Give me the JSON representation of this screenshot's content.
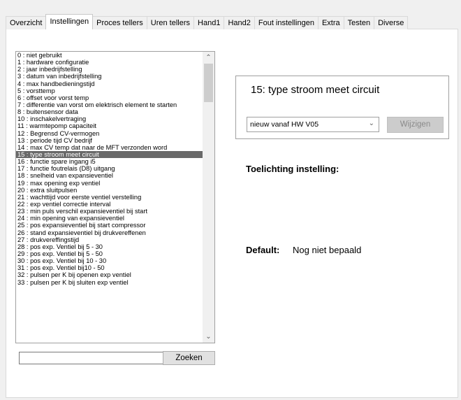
{
  "tabs": [
    {
      "label": "Overzicht",
      "active": false
    },
    {
      "label": "Instellingen",
      "active": true
    },
    {
      "label": "Proces tellers",
      "active": false
    },
    {
      "label": "Uren tellers",
      "active": false
    },
    {
      "label": "Hand1",
      "active": false
    },
    {
      "label": "Hand2",
      "active": false
    },
    {
      "label": "Fout instellingen",
      "active": false
    },
    {
      "label": "Extra",
      "active": false
    },
    {
      "label": "Testen",
      "active": false
    },
    {
      "label": "Diverse",
      "active": false
    }
  ],
  "settings_list": {
    "selected_index": 15,
    "items": [
      "0 : niet gebruikt",
      "1 : hardware configuratie",
      "2 : jaar inbedrijfstelling",
      "3 : datum van inbedrijfstelling",
      "4 : max handbedieningstijd",
      "5 : vorsttemp",
      "6 : offset voor vorst temp",
      "7 : differentie van vorst om elektrisch element te starten",
      "8 : buitensensor data",
      "10 : inschakelvertraging",
      "11 : warmtepomp capaciteit",
      "12 : Begrensd CV-vermogen",
      "13 : periode tijd CV bedrijf",
      "14 : max CV temp dat naar de MFT verzonden word",
      "15 : type stroom meet circuit",
      "16 : functie spare ingang i5",
      "17 : functie foutrelais (D8) uitgang",
      "18 : snelheid van expansieventiel",
      "19 : max opening exp ventiel",
      "20 : extra sluitpulsen",
      "21 : wachttijd voor eerste ventiel verstelling",
      "22 : exp ventiel correctie interval",
      "23 : min puls verschil expansieventiel bij start",
      "24 : min opening van expansieventiel",
      "25 : pos expansieventiel bij start compressor",
      "26 : stand expansieventiel bij drukvereffenen",
      "27 : drukvereffingstijd",
      "28 : pos exp. Ventiel bij 5 - 30",
      "29 : pos exp. Ventiel bij 5 - 50",
      "30 : pos exp. Ventiel bij 10 - 30",
      "31 : pos exp. Ventiel bij10 - 50",
      "32 : pulsen per K bij openen exp ventiel",
      "33 : pulsen per K bij sluiten exp ventiel"
    ]
  },
  "search": {
    "value": "",
    "button_label": "Zoeken"
  },
  "setting_detail": {
    "title": "15: type stroom meet circuit",
    "select_value": "nieuw vanaf HW V05",
    "change_button_label": "Wijzigen",
    "explanation_heading": "Toelichting instelling:",
    "default_label": "Default:",
    "default_value": "Nog niet bepaald"
  },
  "icons": {
    "scroll_up": "chevron-up",
    "scroll_down": "chevron-down",
    "dropdown": "chevron-down"
  },
  "colors": {
    "selected_row": "#696969",
    "panel": "#ffffff",
    "window": "#f0f0f0"
  }
}
